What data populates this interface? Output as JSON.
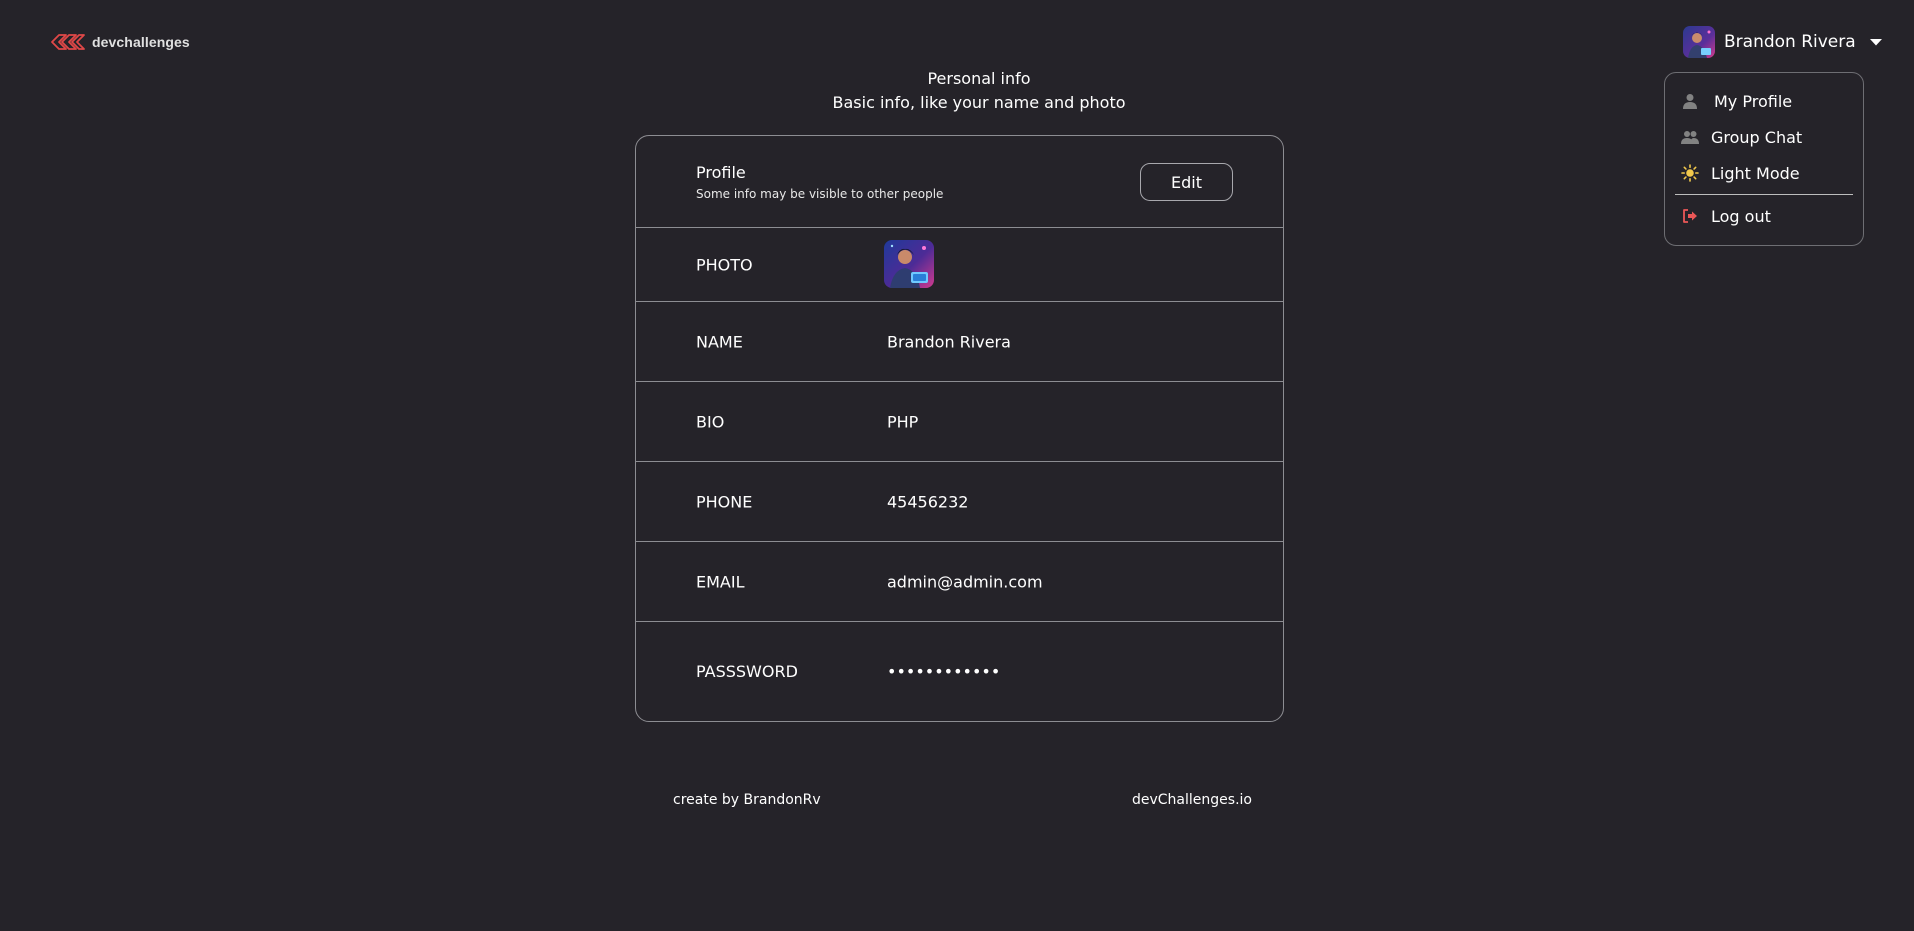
{
  "header": {
    "logo_text": "devchallenges",
    "user_name": "Brandon Rivera"
  },
  "dropdown": {
    "items": [
      {
        "label": "My Profile",
        "icon": "user-icon"
      },
      {
        "label": "Group Chat",
        "icon": "group-icon"
      },
      {
        "label": "Light Mode",
        "icon": "sun-icon"
      },
      {
        "label": "Log out",
        "icon": "logout-icon"
      }
    ]
  },
  "heading": {
    "title": "Personal info",
    "subtitle": "Basic info, like your name and photo"
  },
  "card": {
    "title": "Profile",
    "subtitle": "Some info may be visible to other people",
    "edit_label": "Edit",
    "rows": [
      {
        "label": "PHOTO",
        "value": ""
      },
      {
        "label": "NAME",
        "value": "Brandon Rivera"
      },
      {
        "label": "BIO",
        "value": "PHP"
      },
      {
        "label": "PHONE",
        "value": "45456232"
      },
      {
        "label": "EMAIL",
        "value": "admin@admin.com"
      },
      {
        "label": "PASSSWORD",
        "value": "••••••••••••"
      }
    ]
  },
  "footer": {
    "left": "create by BrandonRv",
    "right": "devChallenges.io"
  },
  "colors": {
    "background": "#252329",
    "border": "#8d8d92",
    "logo_red": "#e04848",
    "sun_yellow": "#f2c94c",
    "logout_red": "#eb5757"
  }
}
